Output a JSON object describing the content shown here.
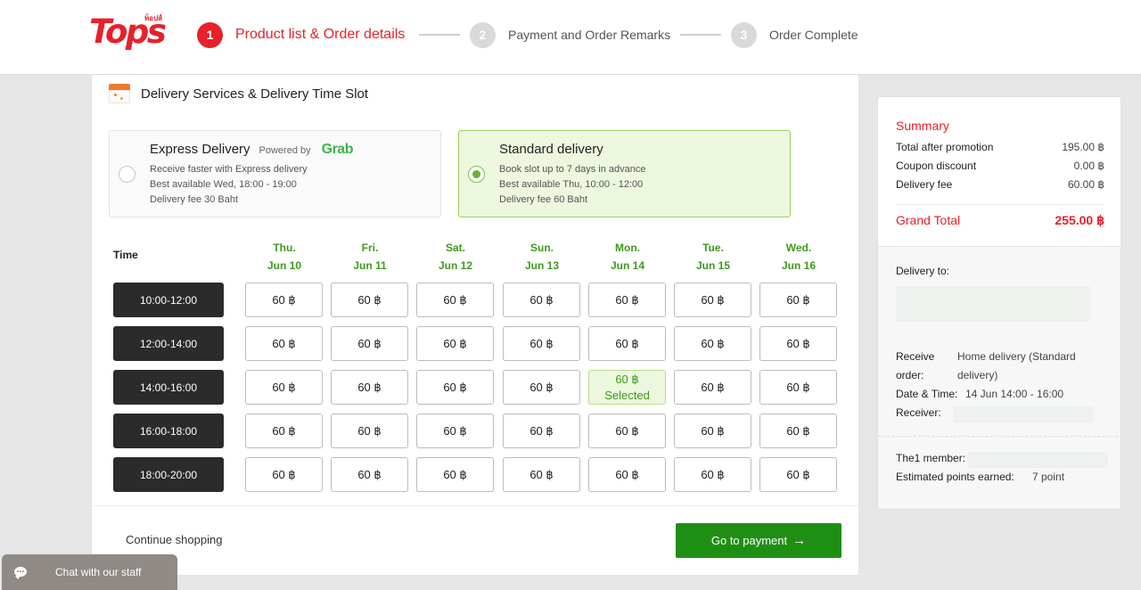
{
  "header": {
    "logo": "Tops",
    "logo_sub": "ท็อปส์",
    "steps": [
      {
        "num": "1",
        "label": "Product list & Order details"
      },
      {
        "num": "2",
        "label": "Payment and Order Remarks"
      },
      {
        "num": "3",
        "label": "Order Complete"
      }
    ]
  },
  "delivery": {
    "section_title": "Delivery Services & Delivery Time Slot",
    "express": {
      "title": "Express Delivery",
      "powered": "Powered by",
      "brand": "Grab",
      "lines": [
        "Receive faster with Express delivery",
        "Best available Wed, 18:00 - 19:00",
        "Delivery fee 30 Baht"
      ]
    },
    "standard": {
      "title": "Standard delivery",
      "lines": [
        "Book slot up to 7 days in advance",
        "Best available Thu, 10:00 - 12:00",
        "Delivery fee 60 Baht"
      ]
    },
    "time_label": "Time",
    "days": [
      {
        "dow": "Thu.",
        "date": "Jun 10"
      },
      {
        "dow": "Fri.",
        "date": "Jun 11"
      },
      {
        "dow": "Sat.",
        "date": "Jun 12"
      },
      {
        "dow": "Sun.",
        "date": "Jun 13"
      },
      {
        "dow": "Mon.",
        "date": "Jun 14"
      },
      {
        "dow": "Tue.",
        "date": "Jun 15"
      },
      {
        "dow": "Wed.",
        "date": "Jun 16"
      }
    ],
    "slots": [
      "10:00-12:00",
      "12:00-14:00",
      "14:00-16:00",
      "16:00-18:00",
      "18:00-20:00"
    ],
    "price": "60 ฿",
    "selected_label": "Selected",
    "selected": {
      "slot": 2,
      "day": 4
    }
  },
  "footer": {
    "continue": "Continue shopping",
    "pay": "Go to payment",
    "pay_arrow": "→"
  },
  "summary": {
    "title": "Summary",
    "rows": [
      {
        "label": "Total after promotion",
        "value": "195.00 ฿"
      },
      {
        "label": "Coupon discount",
        "value": "0.00 ฿"
      },
      {
        "label": "Delivery fee",
        "value": "60.00 ฿"
      }
    ],
    "grand_label": "Grand Total",
    "grand_value": "255.00 ฿",
    "delivery_to": "Delivery to:",
    "receive_k1": "Receive",
    "receive_k2": "order:",
    "receive_v1": "Home delivery (Standard",
    "receive_v2": "delivery)",
    "datetime_k": "Date & Time:",
    "datetime_v": "14 Jun 14:00 - 16:00",
    "receiver_k": "Receiver:",
    "member_k": "The1 member:",
    "points_k": "Estimated points earned:",
    "points_v": "7 point"
  },
  "chat": {
    "label": "Chat with our staff"
  },
  "colors": {
    "brand": "#e8202a",
    "accent_green": "#3d9a1c",
    "button_green": "#1f8f14",
    "grab": "#3ab54a"
  }
}
